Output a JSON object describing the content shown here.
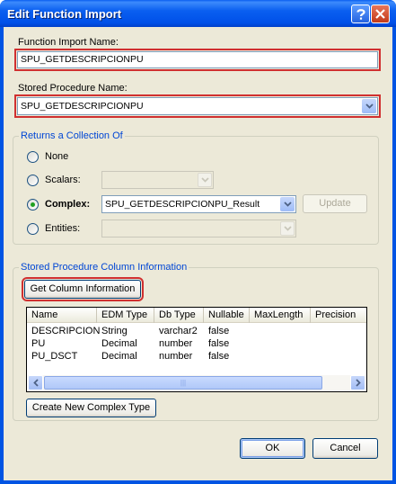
{
  "window": {
    "title": "Edit Function Import"
  },
  "function_import": {
    "label": "Function Import Name:",
    "value": "SPU_GETDESCRIPCIONPU"
  },
  "stored_procedure": {
    "label": "Stored Procedure Name:",
    "value": "SPU_GETDESCRIPCIONPU"
  },
  "returns": {
    "legend": "Returns a Collection Of",
    "none_label": "None",
    "scalars_label": "Scalars:",
    "complex_label": "Complex:",
    "complex_value": "SPU_GETDESCRIPCIONPU_Result",
    "entities_label": "Entities:",
    "update_label": "Update",
    "selected": "complex"
  },
  "column_info": {
    "legend": "Stored Procedure Column Information",
    "get_button": "Get Column Information",
    "columns": [
      "Name",
      "EDM Type",
      "Db Type",
      "Nullable",
      "MaxLength",
      "Precision"
    ],
    "rows": [
      [
        "DESCRIPCION",
        "String",
        "varchar2",
        "false",
        "",
        ""
      ],
      [
        "PU",
        "Decimal",
        "number",
        "false",
        "",
        ""
      ],
      [
        "PU_DSCT",
        "Decimal",
        "number",
        "false",
        "",
        ""
      ]
    ],
    "scroll_grip": "|||"
  },
  "create_complex_button": "Create New Complex Type",
  "ok_button": "OK",
  "cancel_button": "Cancel",
  "colors": {
    "titlebar": "#0054e3",
    "dialog_bg": "#ece9d8",
    "highlight_outline": "#d03030",
    "group_legend": "#0046d5"
  }
}
